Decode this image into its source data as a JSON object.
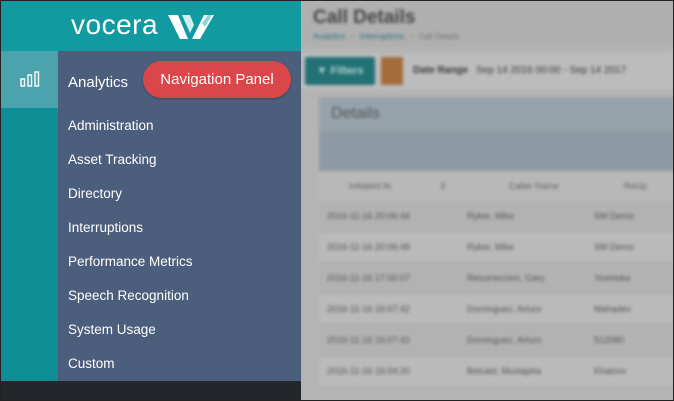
{
  "background": {
    "title": "Call Details",
    "breadcrumb": [
      "Analytics",
      "Interruptions",
      "Call Details"
    ],
    "filters_label": "Filters",
    "date_range_label": "Date Range",
    "date_range_value": "Sep 14 2016 00:00 - Sep 14 2017",
    "details_label": "Details",
    "table": {
      "columns": [
        "Initiated At",
        "Caller Name",
        "Recip"
      ],
      "rows": [
        [
          "2016-11-16 20:06:44",
          "Ryker, Mike",
          "SM Demo"
        ],
        [
          "2016-11-16 20:06:48",
          "Ryker, Mike",
          "SM Demo"
        ],
        [
          "2016-11-16 17:00:07",
          "Resurreccion, Gary",
          "Yoshioka"
        ],
        [
          "2016-11-16 16:07:42",
          "Dominguez, Arturo",
          "Mahadev"
        ],
        [
          "2016-11-16 16:07:42",
          "Dominguez, Arturo",
          "512080"
        ],
        [
          "2016-11-16 16:04:20",
          "Belcast, Mustapha",
          "Khalzov"
        ]
      ]
    }
  },
  "logo": {
    "text": "vocera",
    "mark_icon": "vocera-v-logo"
  },
  "rail": {
    "active_icon": "bar-chart-icon"
  },
  "nav": {
    "header": "Analytics",
    "items": [
      "Administration",
      "Asset Tracking",
      "Directory",
      "Interruptions",
      "Performance Metrics",
      "Speech Recognition",
      "System Usage",
      "Custom"
    ]
  },
  "callout": {
    "label": "Navigation Panel"
  },
  "colors": {
    "teal": "#119aa0",
    "rail": "#0f8e95",
    "rail_active": "#4aa3ad",
    "panel": "#4b5e7c",
    "callout": "#d9474a"
  }
}
